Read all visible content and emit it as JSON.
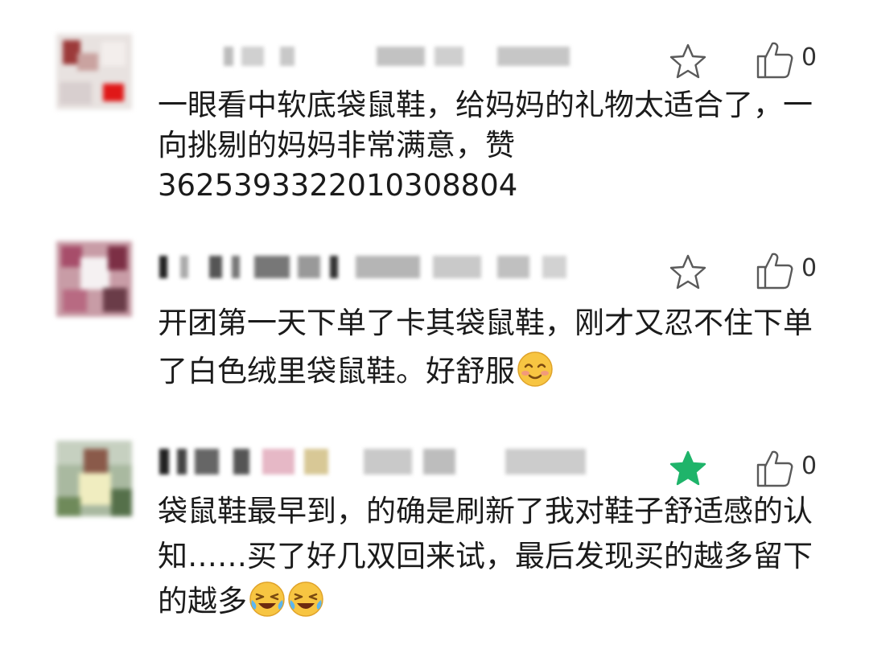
{
  "comments": [
    {
      "text": "一眼看中软底袋鼠鞋，给妈妈的礼物太适合了，一向挑剔的妈妈非常满意，赞",
      "order_number": "3625393322010308804",
      "like_count": "0",
      "starred": false,
      "emojis": []
    },
    {
      "text": "开团第一天下单了卡其袋鼠鞋，刚才又忍不住下单了白色绒里袋鼠鞋。好舒服",
      "like_count": "0",
      "starred": false,
      "emojis": [
        "smiling-blush-emoji"
      ]
    },
    {
      "text": "袋鼠鞋最早到，的确是刷新了我对鞋子舒适感的认知……买了好几双回来试，最后发现买的越多留下的越多",
      "like_count": "0",
      "starred": true,
      "emojis": [
        "laughing-crying-emoji",
        "laughing-crying-emoji"
      ]
    }
  ],
  "colors": {
    "star_active": "#1fb46a",
    "icon_outline": "#5a5a5a",
    "text": "#1b1b1b"
  }
}
